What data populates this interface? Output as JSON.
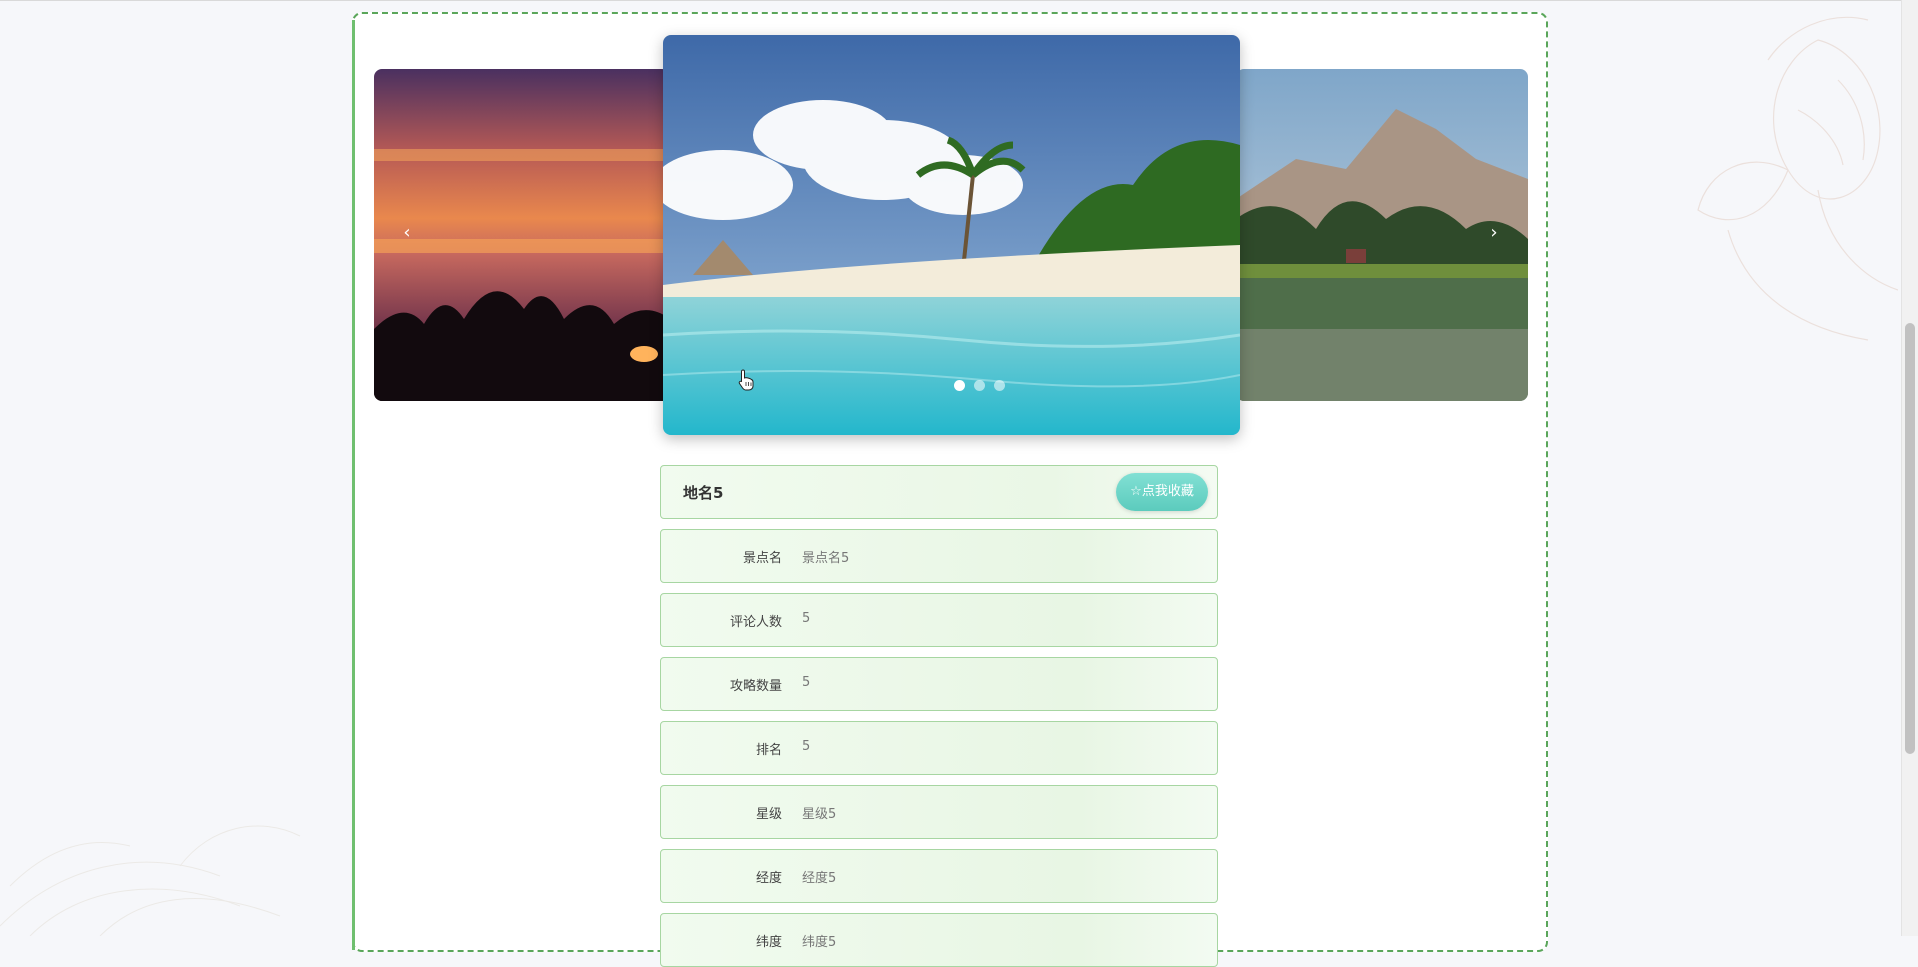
{
  "carousel": {
    "prev_arrow": "‹",
    "next_arrow": "›",
    "slides": [
      "sunset-forest",
      "tropical-beach",
      "mountain-lake"
    ],
    "active_index": 0,
    "dot_count": 3
  },
  "detail": {
    "title": "地名5",
    "favorite_button": "☆点我收藏",
    "rows": [
      {
        "label": "景点名",
        "value": "景点名5"
      },
      {
        "label": "评论人数",
        "value": "5"
      },
      {
        "label": "攻略数量",
        "value": "5"
      },
      {
        "label": "排名",
        "value": "5"
      },
      {
        "label": "星级",
        "value": "星级5"
      },
      {
        "label": "经度",
        "value": "经度5"
      },
      {
        "label": "纬度",
        "value": "纬度5"
      }
    ]
  },
  "colors": {
    "accent": "#5ccbbd",
    "border_green": "#5aa65a",
    "row_border": "#a7d6a2"
  }
}
